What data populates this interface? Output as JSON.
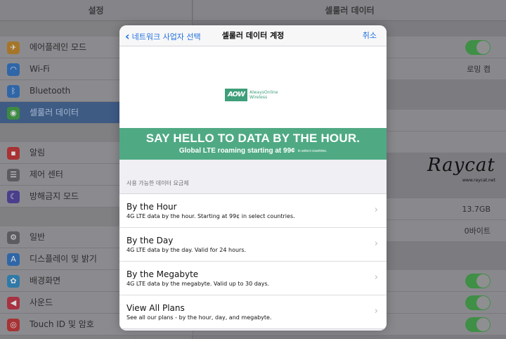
{
  "settings_sidebar": {
    "title": "설정",
    "items": [
      {
        "label": "에어플레인 모드",
        "icon": "airplane-icon",
        "color": "#a5762a"
      },
      {
        "label": "Wi-Fi",
        "icon": "wifi-icon",
        "color": "#2f66a8"
      },
      {
        "label": "Bluetooth",
        "icon": "bluetooth-icon",
        "color": "#2f66a8"
      },
      {
        "label": "셀룰러 데이터",
        "icon": "cellular-icon",
        "color": "#3d8a43"
      },
      {
        "label": "알림",
        "icon": "notifications-icon",
        "color": "#a83234"
      },
      {
        "label": "제어 센터",
        "icon": "control-center-icon",
        "color": "#5c5c60"
      },
      {
        "label": "방해금지 모드",
        "icon": "moon-icon",
        "color": "#4a3f8c"
      },
      {
        "label": "일반",
        "icon": "gear-icon",
        "color": "#5c5c60"
      },
      {
        "label": "디스플레이 및 밝기",
        "icon": "display-icon",
        "color": "#2f66a8"
      },
      {
        "label": "배경화면",
        "icon": "wallpaper-icon",
        "color": "#2f7aa8"
      },
      {
        "label": "사운드",
        "icon": "sound-icon",
        "color": "#a83242"
      },
      {
        "label": "Touch ID 및 암호",
        "icon": "fingerprint-icon",
        "color": "#a83234"
      }
    ]
  },
  "cellular_pane": {
    "title": "셀룰러 데이터",
    "roaming_label": "로밍 켬",
    "usage_value": "13.7GB",
    "roaming_usage_value": "0바이트",
    "accent_toggle": "#3f8f46"
  },
  "watermark": {
    "word": "Raycat",
    "url": "www.raycat.net"
  },
  "modal": {
    "back_label": "네트워크 사업자 선택",
    "title": "셀룰러 데이터 계정",
    "cancel_label": "취소",
    "link_color": "#1f6fde",
    "logo": {
      "mark": "AOW",
      "line1": "AlwaysOnline",
      "line2": "Wireless"
    },
    "banner": {
      "headline": "SAY HELLO TO DATA BY THE HOUR.",
      "subline": "Global LTE roaming starting at 99¢",
      "fine_print": "in select countries.",
      "color": "#4faa84"
    },
    "section_header": "사용 가능한 데이터 요금제",
    "plans": [
      {
        "title": "By the Hour",
        "desc": "4G LTE data by the hour. Starting at 99¢ in select countries."
      },
      {
        "title": "By the Day",
        "desc": "4G LTE data by the day. Valid for 24 hours."
      },
      {
        "title": "By the Megabyte",
        "desc": "4G LTE data by the megabyte. Valid up to 30 days."
      },
      {
        "title": "View All Plans",
        "desc": "See all our plans - by the hour, day, and megabyte."
      }
    ]
  }
}
